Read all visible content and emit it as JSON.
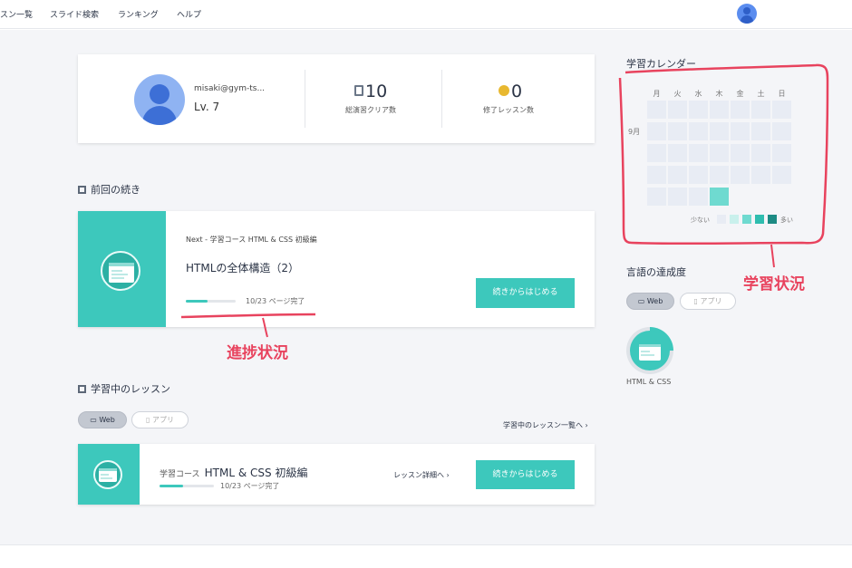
{
  "nav": {
    "items": [
      "スン一覧",
      "スライド検索",
      "ランキング",
      "ヘルプ"
    ]
  },
  "profile": {
    "username": "misaki@gym-ts...",
    "level": "Lv. 7",
    "stats": [
      {
        "value": "10",
        "label": "総演習クリア数",
        "icon": "book-icon"
      },
      {
        "value": "0",
        "label": "修了レッスン数",
        "icon": "medal-icon"
      }
    ]
  },
  "resume": {
    "section_title": "前回の続き",
    "subtitle": "Next - 学習コース HTML & CSS 初級編",
    "title": "HTMLの全体構造（2）",
    "progress_text": "10/23 ページ完了",
    "progress": 0.43,
    "button": "続きからはじめる"
  },
  "lessons": {
    "section_title": "学習中のレッスン",
    "tabs": [
      {
        "label": "Web",
        "active": true,
        "icon": "window-icon"
      },
      {
        "label": "アプリ",
        "active": false,
        "icon": "phone-icon"
      }
    ],
    "list_link": "学習中のレッスン一覧へ ›",
    "items": [
      {
        "prefix": "学習コース",
        "title": "HTML & CSS 初級編",
        "progress_text": "10/23 ページ完了",
        "progress": 0.43,
        "detail_link": "レッスン詳細へ ›",
        "button": "続きからはじめる"
      }
    ]
  },
  "calendar": {
    "title": "学習カレンダー",
    "weekdays": [
      "月",
      "火",
      "水",
      "木",
      "金",
      "土",
      "日"
    ],
    "month_label": "9月",
    "legend_less": "少ない",
    "legend_more": "多い",
    "active_cell": {
      "row": 4,
      "col": 3
    },
    "colors": {
      "empty": "#e8ecf4",
      "l1": "#c9f0ec",
      "l2": "#6fdad0",
      "l3": "#2fbdaf",
      "l4": "#1d8b84"
    }
  },
  "languages": {
    "title": "言語の達成度",
    "tabs": [
      {
        "label": "Web",
        "active": true,
        "icon": "window-icon"
      },
      {
        "label": "アプリ",
        "active": false,
        "icon": "phone-icon"
      }
    ],
    "items": [
      {
        "label": "HTML & CSS",
        "progress": 0.25
      }
    ]
  },
  "annotations": {
    "calendar": "学習状況",
    "progress": "進捗状況"
  },
  "colors": {
    "accent": "#3dc8bc",
    "annotation": "#e8435e",
    "avatar": "#5b8def"
  }
}
